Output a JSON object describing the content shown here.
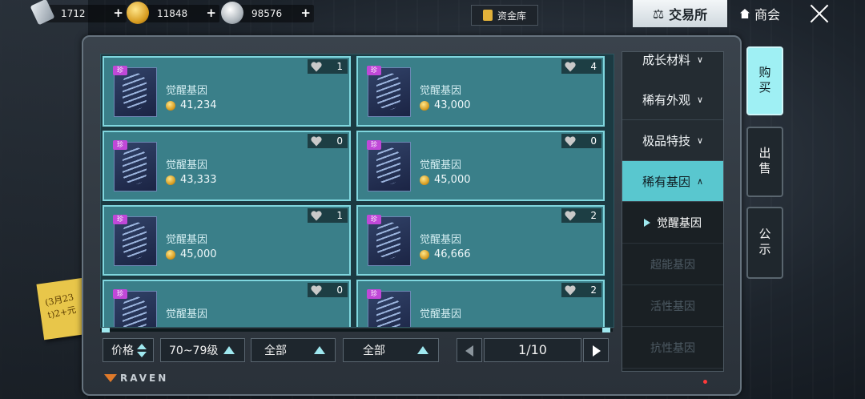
{
  "currencies": [
    {
      "icon": "crystal-card-icon",
      "value": "1712"
    },
    {
      "icon": "gold-coin-icon",
      "value": "11848"
    },
    {
      "icon": "silver-coin-icon",
      "value": "98576"
    }
  ],
  "header": {
    "fund_label": "资金库",
    "exchange_label": "交易所",
    "shop_label": "商会"
  },
  "listings": [
    {
      "badge": "珍",
      "name": "觉醒基因",
      "price": "41,234",
      "likes": "1"
    },
    {
      "badge": "珍",
      "name": "觉醒基因",
      "price": "43,000",
      "likes": "4"
    },
    {
      "badge": "珍",
      "name": "觉醒基因",
      "price": "43,333",
      "likes": "0"
    },
    {
      "badge": "珍",
      "name": "觉醒基因",
      "price": "45,000",
      "likes": "0"
    },
    {
      "badge": "珍",
      "name": "觉醒基因",
      "price": "45,000",
      "likes": "1"
    },
    {
      "badge": "珍",
      "name": "觉醒基因",
      "price": "46,666",
      "likes": "2"
    },
    {
      "badge": "珍",
      "name": "觉醒基因",
      "price": "",
      "likes": "0"
    },
    {
      "badge": "珍",
      "name": "觉醒基因",
      "price": "",
      "likes": "2"
    }
  ],
  "filters": {
    "sort_label": "价格",
    "level_label": "70~79级",
    "filter1_label": "全部",
    "filter2_label": "全部"
  },
  "pagination": {
    "current": "1/10"
  },
  "logo": "RAVEN",
  "categories": [
    {
      "label": "成长材料",
      "chev": "∨"
    },
    {
      "label": "稀有外观",
      "chev": "∨"
    },
    {
      "label": "极品特技",
      "chev": "∨"
    },
    {
      "label": "稀有基因",
      "chev": "∧"
    }
  ],
  "subcategories": [
    "觉醒基因",
    "超能基因",
    "活性基因",
    "抗性基因"
  ],
  "side_tabs": [
    "购买",
    "出售",
    "公示"
  ],
  "sticky_note": "(3月23 t)2+元"
}
